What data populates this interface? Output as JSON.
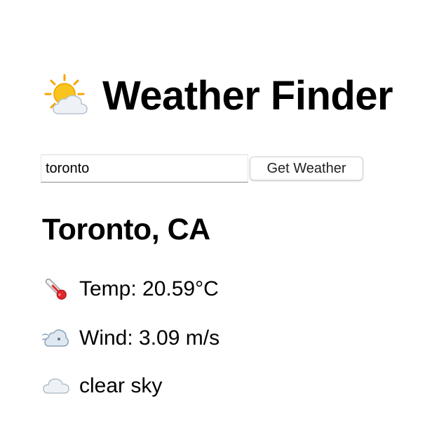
{
  "header": {
    "icon": "sun-behind-cloud-icon",
    "title": "Weather Finder"
  },
  "search": {
    "value": "toronto",
    "button_label": "Get Weather"
  },
  "result": {
    "city": "Toronto, CA",
    "temp": {
      "icon": "thermometer-icon",
      "text": "Temp: 20.59°C"
    },
    "wind": {
      "icon": "wind-face-icon",
      "text": "Wind: 3.09 m/s"
    },
    "description": {
      "icon": "cloud-icon",
      "text": "clear sky"
    }
  },
  "colors": {
    "text": "#000000",
    "background": "#ffffff",
    "sun": "#f7b500",
    "cloud": "#e8edf2",
    "thermometer_red": "#e0282e"
  }
}
